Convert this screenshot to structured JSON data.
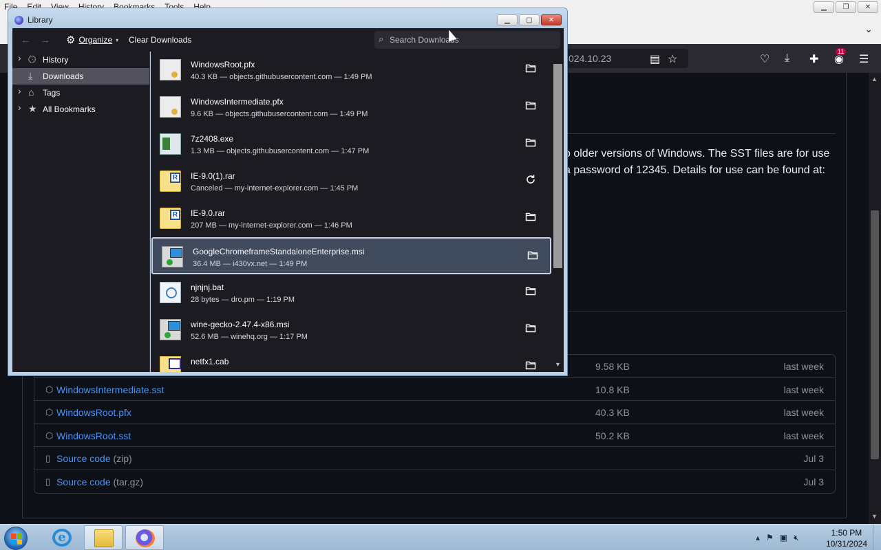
{
  "firefox": {
    "menu": [
      "File",
      "Edit",
      "View",
      "History",
      "Bookmarks",
      "Tools",
      "Help"
    ],
    "url_fragment": "024.10.23",
    "extension_badge": "11",
    "page_text_line1": "o older versions of Windows. The SST files are for use",
    "page_text_line2": "a password of 12345. Details for use can be found at:",
    "assets": [
      {
        "name": "",
        "suffix": "",
        "size": "9.58 KB",
        "date": "last week",
        "icon": "package-icon"
      },
      {
        "name": "WindowsIntermediate.sst",
        "suffix": "",
        "size": "10.8 KB",
        "date": "last week",
        "icon": "package-icon"
      },
      {
        "name": "WindowsRoot.pfx",
        "suffix": "",
        "size": "40.3 KB",
        "date": "last week",
        "icon": "package-icon"
      },
      {
        "name": "WindowsRoot.sst",
        "suffix": "",
        "size": "50.2 KB",
        "date": "last week",
        "icon": "package-icon"
      },
      {
        "name": "Source code",
        "suffix": "(zip)",
        "size": "",
        "date": "Jul 3",
        "icon": "file-zip-icon"
      },
      {
        "name": "Source code",
        "suffix": "(tar.gz)",
        "size": "",
        "date": "Jul 3",
        "icon": "file-zip-icon"
      }
    ]
  },
  "library": {
    "title": "Library",
    "toolbar": {
      "organize_label": "Organize",
      "clear_label": "Clear Downloads",
      "search_placeholder": "Search Downloads"
    },
    "sidebar": [
      {
        "label": "History",
        "icon": "clock-icon",
        "twisty": true,
        "selected": false
      },
      {
        "label": "Downloads",
        "icon": "download-icon",
        "twisty": false,
        "selected": true
      },
      {
        "label": "Tags",
        "icon": "tag-icon",
        "twisty": true,
        "selected": false
      },
      {
        "label": "All Bookmarks",
        "icon": "star-icon",
        "twisty": true,
        "selected": false
      }
    ],
    "downloads": [
      {
        "name": "WindowsRoot.pfx",
        "meta": "40.3 KB — objects.githubusercontent.com — 1:49 PM",
        "icon": "certificate-file-icon",
        "action": "show-in-folder",
        "selected": false
      },
      {
        "name": "WindowsIntermediate.pfx",
        "meta": "9.6 KB — objects.githubusercontent.com — 1:49 PM",
        "icon": "certificate-file-icon",
        "action": "show-in-folder",
        "selected": false
      },
      {
        "name": "7z2408.exe",
        "meta": "1.3 MB — objects.githubusercontent.com — 1:47 PM",
        "icon": "executable-file-icon",
        "action": "show-in-folder",
        "selected": false
      },
      {
        "name": "IE-9.0(1).rar",
        "meta": "Canceled — my-internet-explorer.com — 1:45 PM",
        "icon": "rar-archive-icon",
        "action": "retry",
        "selected": false
      },
      {
        "name": "IE-9.0.rar",
        "meta": "207 MB — my-internet-explorer.com — 1:46 PM",
        "icon": "rar-archive-icon",
        "action": "show-in-folder",
        "selected": false
      },
      {
        "name": "GoogleChromeframeStandaloneEnterprise.msi",
        "meta": "36.4 MB — i430vx.net — 1:49 PM",
        "icon": "msi-installer-icon",
        "action": "show-in-folder",
        "selected": true
      },
      {
        "name": "njnjnj.bat",
        "meta": "28 bytes — dro.pm — 1:19 PM",
        "icon": "batch-file-icon",
        "action": "show-in-folder",
        "selected": false
      },
      {
        "name": "wine-gecko-2.47.4-x86.msi",
        "meta": "52.6 MB — winehq.org — 1:17 PM",
        "icon": "msi-installer-icon",
        "action": "show-in-folder",
        "selected": false
      },
      {
        "name": "netfx1.cab",
        "meta": "",
        "icon": "cab-archive-icon",
        "action": "show-in-folder",
        "selected": false
      }
    ]
  },
  "taskbar": {
    "apps": [
      "internet-explorer",
      "file-explorer",
      "firefox"
    ],
    "time": "1:50 PM",
    "date": "10/31/2024"
  }
}
